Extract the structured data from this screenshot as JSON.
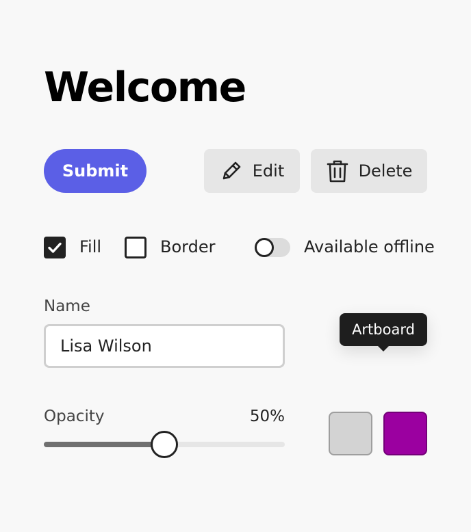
{
  "header": {
    "title": "Welcome"
  },
  "actions": {
    "submit_label": "Submit",
    "edit_label": "Edit",
    "delete_label": "Delete",
    "edit_icon": "pencil-icon",
    "delete_icon": "trash-icon",
    "accent_color": "#5b5fe6"
  },
  "options": {
    "fill": {
      "label": "Fill",
      "checked": true
    },
    "border": {
      "label": "Border",
      "checked": false
    },
    "offline": {
      "label": "Available offline",
      "on": false
    }
  },
  "name_field": {
    "label": "Name",
    "value": "Lisa Wilson"
  },
  "tooltip": {
    "text": "Artboard"
  },
  "opacity": {
    "label": "Opacity",
    "value_text": "50%",
    "value": 0.5
  },
  "swatches": [
    {
      "color": "#d3d3d3"
    },
    {
      "color": "#9b00a0"
    }
  ]
}
